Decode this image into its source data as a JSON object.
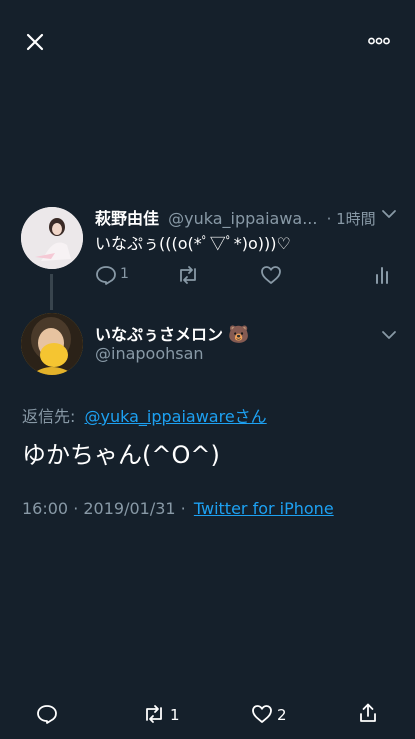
{
  "top_bar": {
    "close_icon": "close-icon",
    "more_icon": "more-icon"
  },
  "parent_tweet": {
    "display_name": "萩野由佳",
    "handle": "@yuka_ippaiawa...",
    "time": "· 1時間",
    "text": "いなぷぅ(((o(*ﾟ▽ﾟ*)o)))♡",
    "reply_count": "1"
  },
  "reply_tweet": {
    "display_name": "いなぷぅさメロン",
    "name_emoji": "🐻",
    "handle": "@inapoohsan",
    "replying_to_label": "返信先:",
    "replying_to_link": "@yuka_ippaiawareさん",
    "text": "ゆかちゃん(^O^)",
    "timestamp": "16:00 · 2019/01/31 ·",
    "source": "Twitter for iPhone"
  },
  "bottom_bar": {
    "retweet_count": "1",
    "like_count": "2"
  },
  "colors": {
    "background": "#15202b",
    "muted": "#8899a6",
    "link": "#1da1f2"
  }
}
